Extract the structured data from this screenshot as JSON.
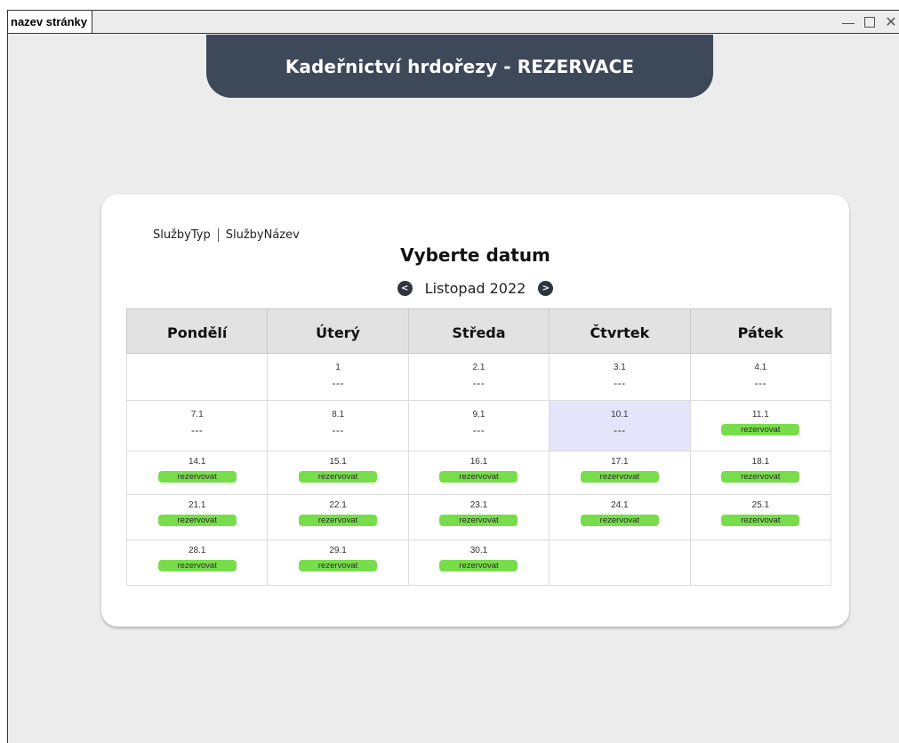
{
  "window": {
    "title": "nazev stránky"
  },
  "header": {
    "title": "Kadeřnictví hrdořezy - REZERVACE",
    "color": "#3d4858"
  },
  "breadcrumb": {
    "item1": "SlužbyTyp",
    "item2": "SlužbyNázev"
  },
  "page_heading": "Vyberte datum",
  "month_nav": {
    "prev_icon": "chevron-left-icon",
    "label": "Listopad 2022",
    "next_icon": "chevron-right-icon"
  },
  "calendar": {
    "headers": [
      "Pondělí",
      "Úterý",
      "Středa",
      "Čtvrtek",
      "Pátek"
    ],
    "reserve_label": "rezervovat",
    "reserve_color": "#77dd4a",
    "selected_color": "#e4e4fb",
    "rows": [
      [
        {
          "date": "",
          "status": "empty"
        },
        {
          "date": "1",
          "status": "---"
        },
        {
          "date": "2.1",
          "status": "---"
        },
        {
          "date": "3.1",
          "status": "---"
        },
        {
          "date": "4.1",
          "status": "---"
        }
      ],
      [
        {
          "date": "7.1",
          "status": "---"
        },
        {
          "date": "8.1",
          "status": "---"
        },
        {
          "date": "9.1",
          "status": "---"
        },
        {
          "date": "10.1",
          "status": "---",
          "selected": true
        },
        {
          "date": "11.1",
          "status": "rezervovat"
        }
      ],
      [
        {
          "date": "14.1",
          "status": "rezervovat"
        },
        {
          "date": "15.1",
          "status": "rezervovat"
        },
        {
          "date": "16.1",
          "status": "rezervovat"
        },
        {
          "date": "17.1",
          "status": "rezervovat"
        },
        {
          "date": "18.1",
          "status": "rezervovat"
        }
      ],
      [
        {
          "date": "21.1",
          "status": "rezervovat"
        },
        {
          "date": "22.1",
          "status": "rezervovat"
        },
        {
          "date": "23.1",
          "status": "rezervovat"
        },
        {
          "date": "24.1",
          "status": "rezervovat"
        },
        {
          "date": "25.1",
          "status": "rezervovat"
        }
      ],
      [
        {
          "date": "28.1",
          "status": "rezervovat"
        },
        {
          "date": "29.1",
          "status": "rezervovat"
        },
        {
          "date": "30.1",
          "status": "rezervovat"
        },
        {
          "date": "",
          "status": "empty"
        },
        {
          "date": "",
          "status": "empty"
        }
      ]
    ]
  }
}
